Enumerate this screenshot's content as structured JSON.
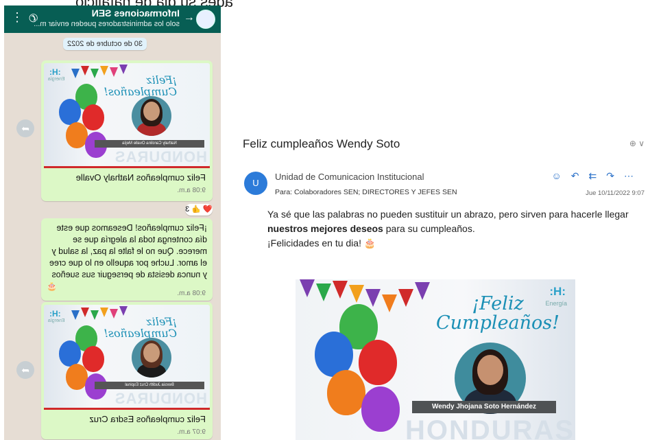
{
  "top_caption": "ades su dia de natalicio",
  "whatsapp": {
    "header": {
      "title": "Informaciones SEN",
      "subtitle": "solo los administradores pueden enviar m..."
    },
    "date_chip": "30 de octubre de 2022",
    "messages": [
      {
        "card": {
          "brand": ":H:",
          "brand_sub": "Energía",
          "feliz": "¡Feliz",
          "feliz2": "Cumpleaños!",
          "name": "Nathaly Carolina Ovalle Mejía",
          "honduras": "HONDURAS"
        },
        "caption": "Feliz cumpleaños Nathaly Ovalle",
        "time": "9:08 a.m.",
        "reactions": "❤️ 👍 3"
      },
      {
        "text": "¡Feliz cumpleaños! Deseamos que este día contenga toda la alegría que se merece. Que no le falte la paz, la salud y el amor. Luche por aquello en lo que cree y nunca desista de perseguir sus sueños",
        "emoji": "🎂",
        "time": "9:08 a.m."
      },
      {
        "card": {
          "brand": ":H:",
          "brand_sub": "Energía",
          "feliz": "¡Feliz",
          "feliz2": "Cumpleaños!",
          "name": "Bexsia Judith Cruz Espinal",
          "honduras": "HONDURAS"
        },
        "caption": "Feliz cumpleaños Esdra Cruz",
        "time": "9:07 a.m."
      }
    ]
  },
  "email": {
    "subject": "Feliz cumpleaños Wendy Soto",
    "zoom_icon": "⊕ ∨",
    "avatar_letter": "U",
    "sender": "Unidad de Comunicacion Institucional",
    "to_label": "Para:",
    "recipients": "Colaboradores SEN;  DIRECTORES Y JEFES SEN",
    "date": "Jue 10/11/2022 9:07",
    "body_line1_pre": "Ya sé que las palabras no pueden sustituir un abrazo, pero sirven para hacerle llegar ",
    "body_bold": "nuestros mejores deseos",
    "body_line1_post": " para su cumpleaños.",
    "body_line2": "¡Felicidades en tu dia! 🎂",
    "card": {
      "brand": ":H:",
      "brand_sub": "Energía",
      "feliz": "¡Feliz",
      "feliz2": "Cumpleaños!",
      "name": "Wendy Jhojana Soto Hernández",
      "honduras": "HONDURAS"
    }
  }
}
